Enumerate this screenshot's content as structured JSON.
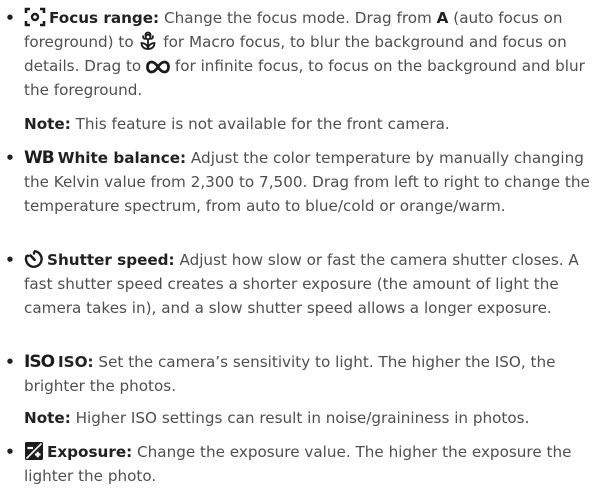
{
  "items": [
    {
      "icon": "focus-range-icon",
      "label": "Focus range:",
      "segments": [
        " Change the focus mode. Drag from ",
        "A",
        " (auto focus on foreground) to ",
        " for Macro focus, to blur the background and focus on details. Drag to ",
        " for infinite focus, to focus on the background and blur the foreground."
      ],
      "inline_icons": [
        "macro-flower-icon",
        "infinity-icon"
      ],
      "note": {
        "label": "Note:",
        "text": " This feature is not available for the front camera."
      }
    },
    {
      "icon": "white-balance-icon",
      "icon_text": "WB",
      "label": "White balance:",
      "text": " Adjust the color temperature by manually changing the Kelvin value from 2,300 to 7,500. Drag from left to right to change the temperature spectrum, from auto to blue/cold or orange/warm."
    },
    {
      "icon": "shutter-speed-icon",
      "label": "Shutter speed:",
      "text": " Adjust how slow or fast the camera shutter closes. A fast shutter speed creates a shorter exposure (the amount of light the camera takes in), and a slow shutter speed allows a longer exposure."
    },
    {
      "icon": "iso-icon",
      "icon_text": "ISO",
      "label": "ISO:",
      "text": " Set the camera’s sensitivity to light. The higher the ISO, the brighter the photos.",
      "note": {
        "label": "Note:",
        "text": " Higher ISO settings can result in noise/graininess in photos."
      }
    },
    {
      "icon": "exposure-icon",
      "label": "Exposure:",
      "text": " Change the exposure value. The higher the exposure the lighter the photo."
    }
  ],
  "bullet": "•"
}
